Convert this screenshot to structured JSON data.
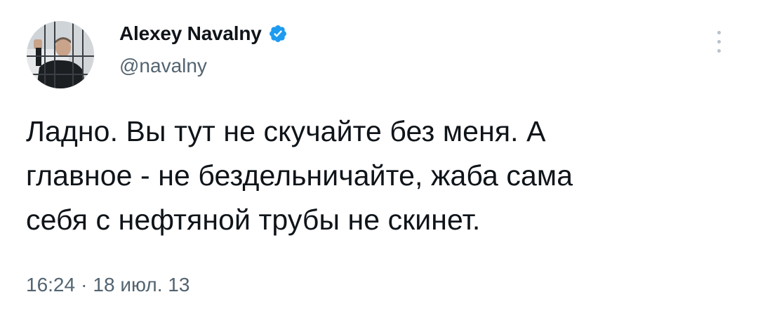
{
  "tweet": {
    "author": {
      "display_name": "Alexey Navalny",
      "handle": "@navalny",
      "verified": true,
      "avatar_icon": "avatar-photo"
    },
    "text": "Ладно. Вы тут не скучайте без меня. А\nглавное - не бездельничайте, жаба сама\nсебя с нефтяной трубы не скинет.",
    "time": "16:24",
    "separator": "·",
    "date": "18 июл. 13"
  },
  "icons": {
    "verified": "verified-badge-icon",
    "more": "more-options-icon"
  },
  "colors": {
    "verified_blue": "#1d9bf0",
    "secondary_text": "#536471",
    "primary_text": "#0f1419"
  }
}
